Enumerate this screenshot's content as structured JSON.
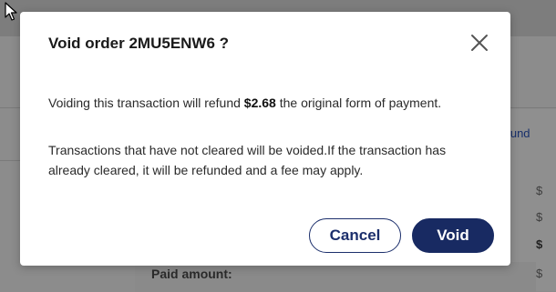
{
  "background": {
    "refund_link": "efund",
    "currency_symbols": [
      "$",
      "$",
      "$",
      "$",
      "$"
    ],
    "paid_amount_label": "Paid amount:"
  },
  "dialog": {
    "title": "Void order 2MU5ENW6 ?",
    "message_prefix": "Voiding this transaction will refund ",
    "refund_amount": "$2.68",
    "message_suffix": " the original form of payment.",
    "note": "Transactions that have not cleared will be voided.If the transaction has already cleared, it will be refunded and a fee may apply.",
    "cancel_label": "Cancel",
    "void_label": "Void",
    "close_icon": "close-icon"
  },
  "colors": {
    "primary": "#182a62",
    "overlay": "#8e8e8e",
    "text": "#2a2a2a"
  }
}
